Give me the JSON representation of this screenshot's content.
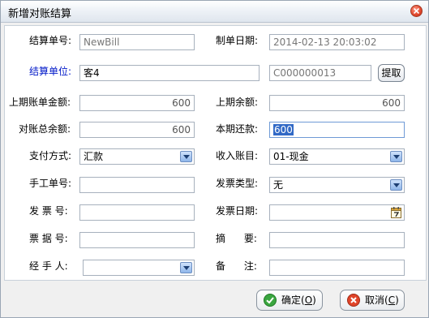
{
  "window": {
    "title": "新增对账结算"
  },
  "form": {
    "settle_no": {
      "label": "结算单号:",
      "value": "NewBill"
    },
    "create_date": {
      "label": "制单日期:",
      "value": "2014-02-13 20:03:02"
    },
    "settle_unit": {
      "label": "结算单位:",
      "value": "客4",
      "code": "C000000013",
      "fetch_label": "提取"
    },
    "prev_bill_amount": {
      "label": "上期账单金额:",
      "value": "600"
    },
    "prev_balance": {
      "label": "上期余额:",
      "value": "600"
    },
    "total_balance": {
      "label": "对账总余额:",
      "value": "600"
    },
    "current_payment": {
      "label": "本期还款:",
      "value": "600"
    },
    "payment_method": {
      "label": "支付方式:",
      "value": "汇款"
    },
    "income_account": {
      "label": "收入账目:",
      "value": "01-现金"
    },
    "manual_no": {
      "label": "手工单号:",
      "value": ""
    },
    "invoice_type": {
      "label": "发票类型:",
      "value": "无"
    },
    "invoice_no": {
      "label": "发 票 号:",
      "value": ""
    },
    "invoice_date": {
      "label": "发票日期:",
      "value": "  -  -"
    },
    "receipt_no": {
      "label": "票 据 号:",
      "value": ""
    },
    "summary": {
      "label": "摘      要:",
      "value": ""
    },
    "handler": {
      "label": "经 手 人:",
      "value": ""
    },
    "remark": {
      "label": "备      注:",
      "value": ""
    }
  },
  "buttons": {
    "ok": {
      "label": "确定(",
      "key": "O",
      "suffix": ")"
    },
    "cancel": {
      "label": "取消(",
      "key": "C",
      "suffix": ")"
    }
  },
  "colors": {
    "label_accent": "#0018c8",
    "selection": "#3169c6"
  }
}
